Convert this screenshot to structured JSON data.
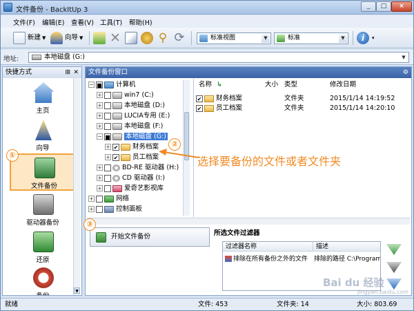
{
  "window": {
    "title": "文件备份 - BackItUp 3",
    "min": "_",
    "max": "□",
    "close": "×"
  },
  "menu": [
    "文件(F)",
    "编辑(E)",
    "查看(V)",
    "工具(T)",
    "帮助(H)"
  ],
  "toolbar": {
    "new_label": "新建",
    "wizard_label": "向导",
    "view_value": "标准视图",
    "mode_value": "标准"
  },
  "address": {
    "label": "地址:",
    "value": "本地磁盘 (G:)"
  },
  "shortcuts": {
    "header": "快捷方式",
    "items": [
      "主页",
      "向导",
      "文件备份",
      "驱动器备份",
      "还原",
      "备份"
    ]
  },
  "backup_window": {
    "header": "文件备份窗口"
  },
  "tree": [
    {
      "label": "计算机"
    },
    {
      "label": "win7 (C:)"
    },
    {
      "label": "本地磁盘 (D:)"
    },
    {
      "label": "LUCIA专用 (E:)"
    },
    {
      "label": "本地磁盘 (F:)"
    },
    {
      "label": "本地磁盘 (G:)"
    },
    {
      "label": "财务档案"
    },
    {
      "label": "员工档案"
    },
    {
      "label": "BD-RE 驱动器 (H:)"
    },
    {
      "label": "CD 驱动器 (I:)"
    },
    {
      "label": "爱奇艺影视库"
    },
    {
      "label": "网络"
    },
    {
      "label": "控制面板"
    }
  ],
  "list": {
    "columns": [
      "名称",
      "大小",
      "类型",
      "修改日期"
    ],
    "rows": [
      {
        "name": "财务档案",
        "size": "",
        "type": "文件夹",
        "date": "2015/1/14 14:19:52"
      },
      {
        "name": "员工档案",
        "size": "",
        "type": "文件夹",
        "date": "2015/1/14 14:20:10"
      }
    ]
  },
  "start_backup": "开始文件备份",
  "filter": {
    "title": "所选文件过滤器",
    "columns": [
      "过滤器名称",
      "描述"
    ],
    "row": {
      "name": "排除在所有备份之外的文件",
      "desc": "排除的路径 C:\\Program"
    }
  },
  "status": {
    "ready": "就绪",
    "files": "文件: 453",
    "folders": "文件夹: 14",
    "size": "大小: 803.69"
  },
  "annotations": {
    "one": "①",
    "two": "②",
    "three": "③",
    "callout": "选择要备份的文件或者文件夹"
  },
  "watermark": {
    "main": "Bai du 经验",
    "sub": "jingyan.baidu.com"
  },
  "colors": {
    "accent": "#3e7ad6",
    "annotation": "#f08a24",
    "selected_bg": "#fde7c5"
  }
}
